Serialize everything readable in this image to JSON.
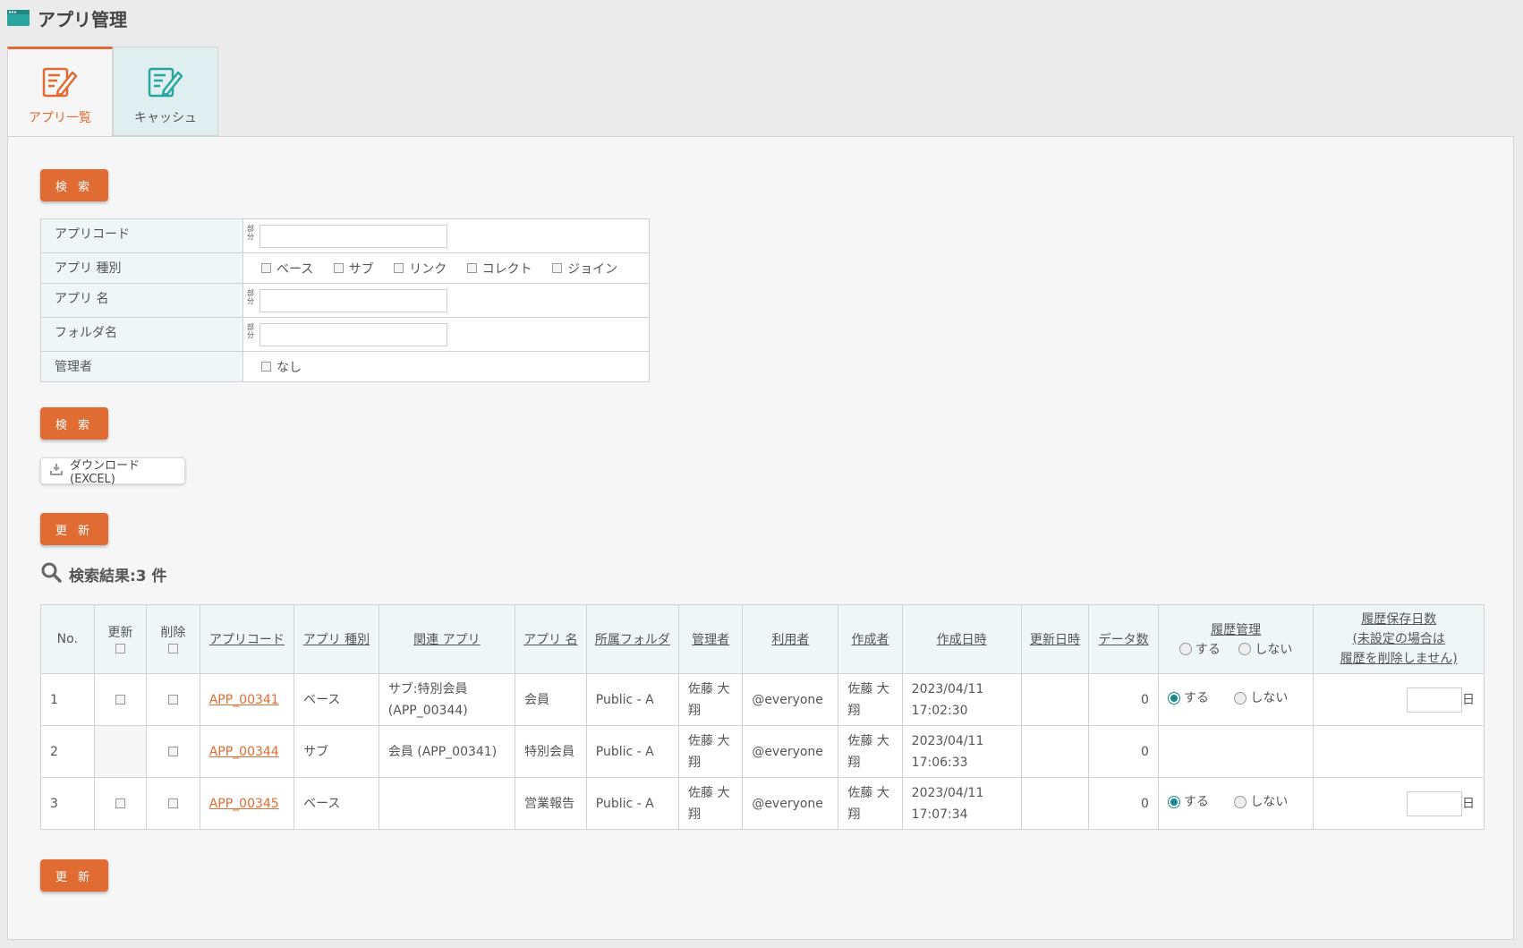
{
  "page": {
    "title": "アプリ管理"
  },
  "tabs": [
    {
      "label": "アプリ一覧",
      "active": true
    },
    {
      "label": "キャッシュ",
      "active": false
    }
  ],
  "buttons": {
    "search": "検 索",
    "update": "更 新",
    "download": "ダウンロード(EXCEL)"
  },
  "search_form": {
    "partial_label": "部分",
    "rows": [
      {
        "label": "アプリコード",
        "type": "text",
        "value": ""
      },
      {
        "label": "アプリ 種別",
        "type": "checks",
        "options": [
          "ベース",
          "サブ",
          "リンク",
          "コレクト",
          "ジョイン"
        ]
      },
      {
        "label": "アプリ 名",
        "type": "text",
        "value": ""
      },
      {
        "label": "フォルダ名",
        "type": "text",
        "value": ""
      },
      {
        "label": "管理者",
        "type": "checks",
        "options": [
          "なし"
        ]
      }
    ]
  },
  "results": {
    "title": "検索結果:3 件",
    "columns": {
      "no": "No.",
      "update": "更新",
      "delete": "削除",
      "code": "アプリコード",
      "kind": "アプリ 種別",
      "related": "関連 アプリ",
      "name": "アプリ 名",
      "folder": "所属フォルダ",
      "admin": "管理者",
      "users": "利用者",
      "creator": "作成者",
      "created": "作成日時",
      "updated": "更新日時",
      "count": "データ数",
      "history": "履歴管理",
      "history_yes": "する",
      "history_no": "しない",
      "retention_1": "履歴保存日数",
      "retention_2": "(未設定の場合は",
      "retention_3": "履歴を削除しません)"
    },
    "day_unit": "日",
    "rows": [
      {
        "no": "1",
        "code": "APP_00341",
        "kind": "ベース",
        "related_1": "サブ:特別会員",
        "related_2": "(APP_00344)",
        "name": "会員",
        "folder": "Public - A",
        "admin_1": "佐藤 大",
        "admin_2": "翔",
        "users": "@everyone",
        "creator_1": "佐藤 大",
        "creator_2": "翔",
        "created_1": "2023/04/11",
        "created_2": "17:02:30",
        "updated": "",
        "count": "0",
        "history_yes": "する",
        "history_no": "しない",
        "history_selected": "yes"
      },
      {
        "no": "2",
        "code": "APP_00344",
        "kind": "サブ",
        "related_1": "会員 (APP_00341)",
        "related_2": "",
        "name": "特別会員",
        "folder": "Public - A",
        "admin_1": "佐藤 大",
        "admin_2": "翔",
        "users": "@everyone",
        "creator_1": "佐藤 大",
        "creator_2": "翔",
        "created_1": "2023/04/11",
        "created_2": "17:06:33",
        "updated": "",
        "count": "0"
      },
      {
        "no": "3",
        "code": "APP_00345",
        "kind": "ベース",
        "related_1": "",
        "related_2": "",
        "name": "営業報告",
        "folder": "Public - A",
        "admin_1": "佐藤 大",
        "admin_2": "翔",
        "users": "@everyone",
        "creator_1": "佐藤 大",
        "creator_2": "翔",
        "created_1": "2023/04/11",
        "created_2": "17:07:34",
        "updated": "",
        "count": "0",
        "history_yes": "する",
        "history_no": "しない",
        "history_selected": "yes"
      }
    ]
  },
  "colors": {
    "accent": "#e06c33",
    "teal": "#2aa6a0",
    "header_bg": "#eef6f6"
  }
}
